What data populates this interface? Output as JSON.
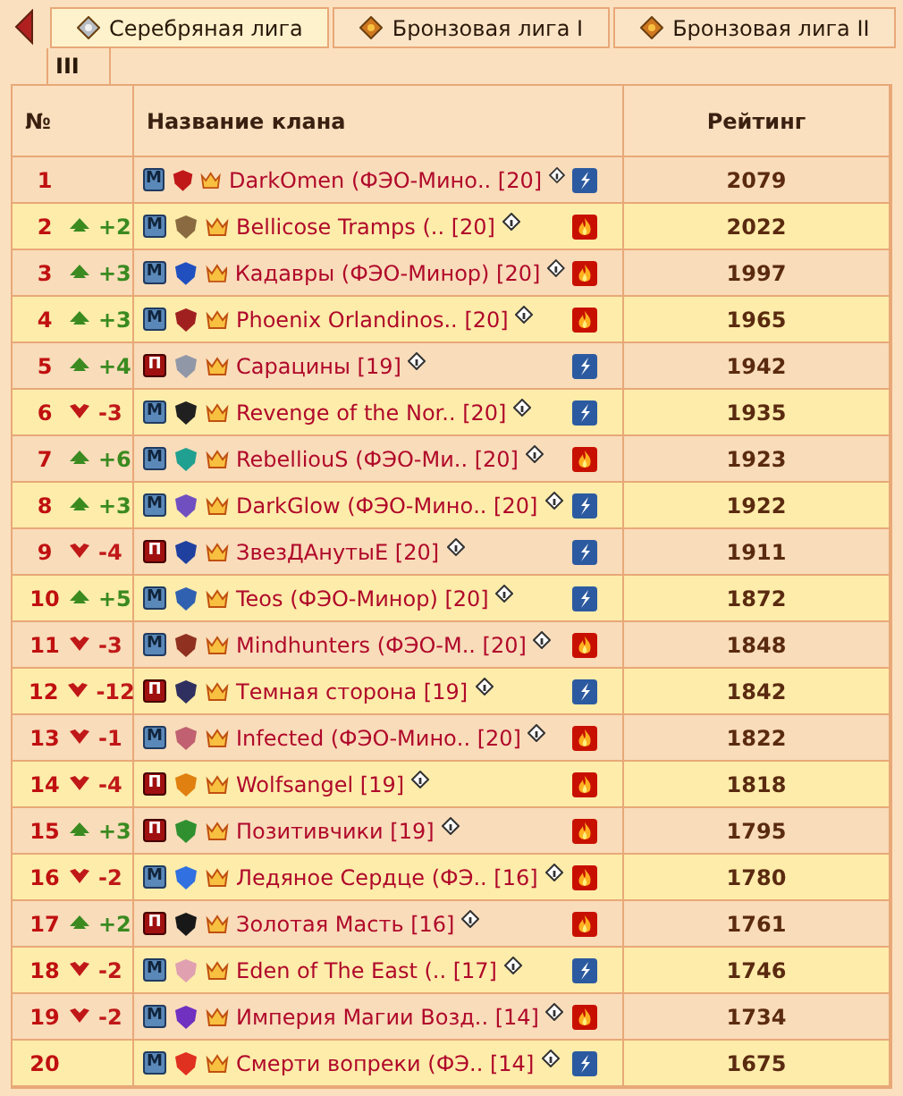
{
  "tabs": [
    {
      "label": "Серебряная лига",
      "selected": true,
      "kind": "silver"
    },
    {
      "label": "Бронзовая лига I",
      "selected": false,
      "kind": "bronze"
    },
    {
      "label": "Бронзовая лига II",
      "selected": false,
      "kind": "bronze"
    },
    {
      "label": "III",
      "selected": false,
      "kind": "plain"
    }
  ],
  "table": {
    "columns": [
      "№",
      "Название клана",
      "Рейтинг"
    ],
    "rows": [
      {
        "rank": "1",
        "badge": {
          "kind": "m",
          "text": "М"
        },
        "color": "#c01818",
        "name": "DarkOmen (ФЭО-Мино.. [20]",
        "element": {
          "kind": "lightning"
        },
        "rating": "2079"
      },
      {
        "rank": "2",
        "change": {
          "kind": "up",
          "text": "+2"
        },
        "badge": {
          "kind": "m",
          "text": "М"
        },
        "color": "#8a6a40",
        "name": "Bellicose Tramps (.. [20]",
        "element": {
          "kind": "fire"
        },
        "rating": "2022"
      },
      {
        "rank": "3",
        "change": {
          "kind": "up",
          "text": "+3"
        },
        "badge": {
          "kind": "m",
          "text": "М"
        },
        "color": "#2050c0",
        "name": "Кадавры (ФЭО-Минор) [20]",
        "element": {
          "kind": "fire"
        },
        "rating": "1997"
      },
      {
        "rank": "4",
        "change": {
          "kind": "up",
          "text": "+3"
        },
        "badge": {
          "kind": "m",
          "text": "М"
        },
        "color": "#a02020",
        "name": "Phoenix Orlandinos.. [20]",
        "element": {
          "kind": "fire"
        },
        "rating": "1965"
      },
      {
        "rank": "5",
        "change": {
          "kind": "up",
          "text": "+4"
        },
        "badge": {
          "kind": "p",
          "text": "П"
        },
        "color": "#9098a8",
        "name": "Сарацины [19]",
        "element": {
          "kind": "lightning"
        },
        "rating": "1942"
      },
      {
        "rank": "6",
        "change": {
          "kind": "down",
          "text": "-3"
        },
        "badge": {
          "kind": "m",
          "text": "М"
        },
        "color": "#202020",
        "name": "Revenge of the Nor.. [20]",
        "element": {
          "kind": "lightning"
        },
        "rating": "1935"
      },
      {
        "rank": "7",
        "change": {
          "kind": "up",
          "text": "+6"
        },
        "badge": {
          "kind": "m",
          "text": "М"
        },
        "color": "#20a090",
        "name": "RebelliouS (ФЭО-Ми.. [20]",
        "element": {
          "kind": "fire"
        },
        "rating": "1923"
      },
      {
        "rank": "8",
        "change": {
          "kind": "up",
          "text": "+3"
        },
        "badge": {
          "kind": "m",
          "text": "М"
        },
        "color": "#7050c0",
        "name": "DarkGlow (ФЭО-Мино.. [20]",
        "element": {
          "kind": "lightning"
        },
        "rating": "1922"
      },
      {
        "rank": "9",
        "change": {
          "kind": "down",
          "text": "-4"
        },
        "badge": {
          "kind": "p",
          "text": "П"
        },
        "color": "#2040a0",
        "name": "ЗвезДАнутыЕ [20]",
        "element": {
          "kind": "lightning"
        },
        "rating": "1911"
      },
      {
        "rank": "10",
        "change": {
          "kind": "up",
          "text": "+5"
        },
        "badge": {
          "kind": "m",
          "text": "М"
        },
        "color": "#3060b0",
        "name": "Teos (ФЭО-Минор) [20]",
        "element": {
          "kind": "lightning"
        },
        "rating": "1872"
      },
      {
        "rank": "11",
        "change": {
          "kind": "down",
          "text": "-3"
        },
        "badge": {
          "kind": "m",
          "text": "М"
        },
        "color": "#903020",
        "name": "Mindhunters (ФЭО-М.. [20]",
        "element": {
          "kind": "fire"
        },
        "rating": "1848"
      },
      {
        "rank": "12",
        "change": {
          "kind": "down",
          "text": "-12"
        },
        "badge": {
          "kind": "p",
          "text": "П"
        },
        "color": "#303060",
        "name": "Темная сторона [19]",
        "element": {
          "kind": "lightning"
        },
        "rating": "1842"
      },
      {
        "rank": "13",
        "change": {
          "kind": "down",
          "text": "-1"
        },
        "badge": {
          "kind": "m",
          "text": "М"
        },
        "color": "#c06070",
        "name": "Infected (ФЭО-Мино.. [20]",
        "element": {
          "kind": "fire"
        },
        "rating": "1822"
      },
      {
        "rank": "14",
        "change": {
          "kind": "down",
          "text": "-4"
        },
        "badge": {
          "kind": "p",
          "text": "П"
        },
        "color": "#e08010",
        "name": "Wolfsangel [19]",
        "element": {
          "kind": "fire"
        },
        "rating": "1818"
      },
      {
        "rank": "15",
        "change": {
          "kind": "up",
          "text": "+3"
        },
        "badge": {
          "kind": "p",
          "text": "П"
        },
        "color": "#309030",
        "name": "Позитивчики [19]",
        "element": {
          "kind": "fire"
        },
        "rating": "1795"
      },
      {
        "rank": "16",
        "change": {
          "kind": "down",
          "text": "-2"
        },
        "badge": {
          "kind": "m",
          "text": "М"
        },
        "color": "#3070e0",
        "name": "Ледяное Сердце (ФЭ.. [16]",
        "element": {
          "kind": "fire"
        },
        "rating": "1780"
      },
      {
        "rank": "17",
        "change": {
          "kind": "up",
          "text": "+2"
        },
        "badge": {
          "kind": "p",
          "text": "П"
        },
        "color": "#181818",
        "name": "Золотая Масть [16]",
        "element": {
          "kind": "fire"
        },
        "rating": "1761"
      },
      {
        "rank": "18",
        "change": {
          "kind": "down",
          "text": "-2"
        },
        "badge": {
          "kind": "m",
          "text": "М"
        },
        "color": "#e0a0b0",
        "name": "Eden of The East (.. [17]",
        "element": {
          "kind": "lightning"
        },
        "rating": "1746"
      },
      {
        "rank": "19",
        "change": {
          "kind": "down",
          "text": "-2"
        },
        "badge": {
          "kind": "m",
          "text": "М"
        },
        "color": "#7030c0",
        "name": "Империя Магии Возд.. [14]",
        "element": {
          "kind": "fire"
        },
        "rating": "1734"
      },
      {
        "rank": "20",
        "badge": {
          "kind": "m",
          "text": "М"
        },
        "color": "#e03020",
        "name": "Смерти вопреки (ФЭ.. [14]",
        "element": {
          "kind": "lightning"
        },
        "rating": "1675"
      }
    ]
  }
}
